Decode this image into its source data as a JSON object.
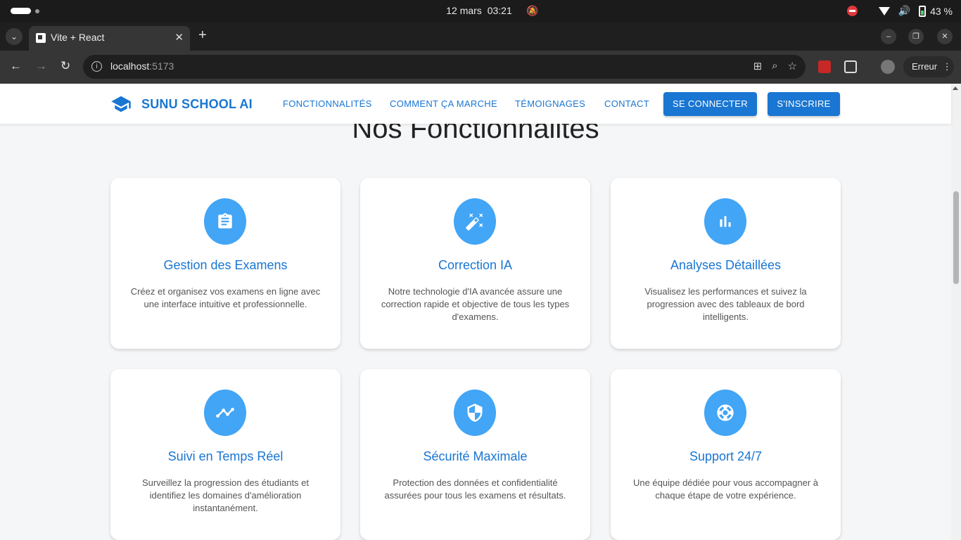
{
  "os": {
    "date": "12 mars",
    "time": "03:21",
    "battery": "43 %"
  },
  "browser": {
    "tab_title": "Vite + React",
    "url_host": "localhost",
    "url_port": ":5173",
    "error_label": "Erreur"
  },
  "header": {
    "brand": "SUNU SCHOOL AI",
    "nav": [
      "FONCTIONNALITÉS",
      "COMMENT ÇA MARCHE",
      "TÉMOIGNAGES",
      "CONTACT"
    ],
    "login": "SE CONNECTER",
    "signup": "S'INSCRIRE"
  },
  "section": {
    "title": "Nos Fonctionnalités"
  },
  "features": [
    {
      "icon": "clipboard-icon",
      "title": "Gestion des Examens",
      "desc": "Créez et organisez vos examens en ligne avec une interface intuitive et professionnelle."
    },
    {
      "icon": "magic-wand-icon",
      "title": "Correction IA",
      "desc": "Notre technologie d'IA avancée assure une correction rapide et objective de tous les types d'examens."
    },
    {
      "icon": "bar-chart-icon",
      "title": "Analyses Détaillées",
      "desc": "Visualisez les performances et suivez la progression avec des tableaux de bord intelligents."
    },
    {
      "icon": "trend-line-icon",
      "title": "Suivi en Temps Réel",
      "desc": "Surveillez la progression des étudiants et identifiez les domaines d'amélioration instantanément."
    },
    {
      "icon": "shield-icon",
      "title": "Sécurité Maximale",
      "desc": "Protection des données et confidentialité assurées pour tous les examens et résultats."
    },
    {
      "icon": "lifebuoy-icon",
      "title": "Support 24/7",
      "desc": "Une équipe dédiée pour vous accompagner à chaque étape de votre expérience."
    }
  ],
  "colors": {
    "primary": "#1976d2",
    "icon_bg": "#42a5f5"
  }
}
